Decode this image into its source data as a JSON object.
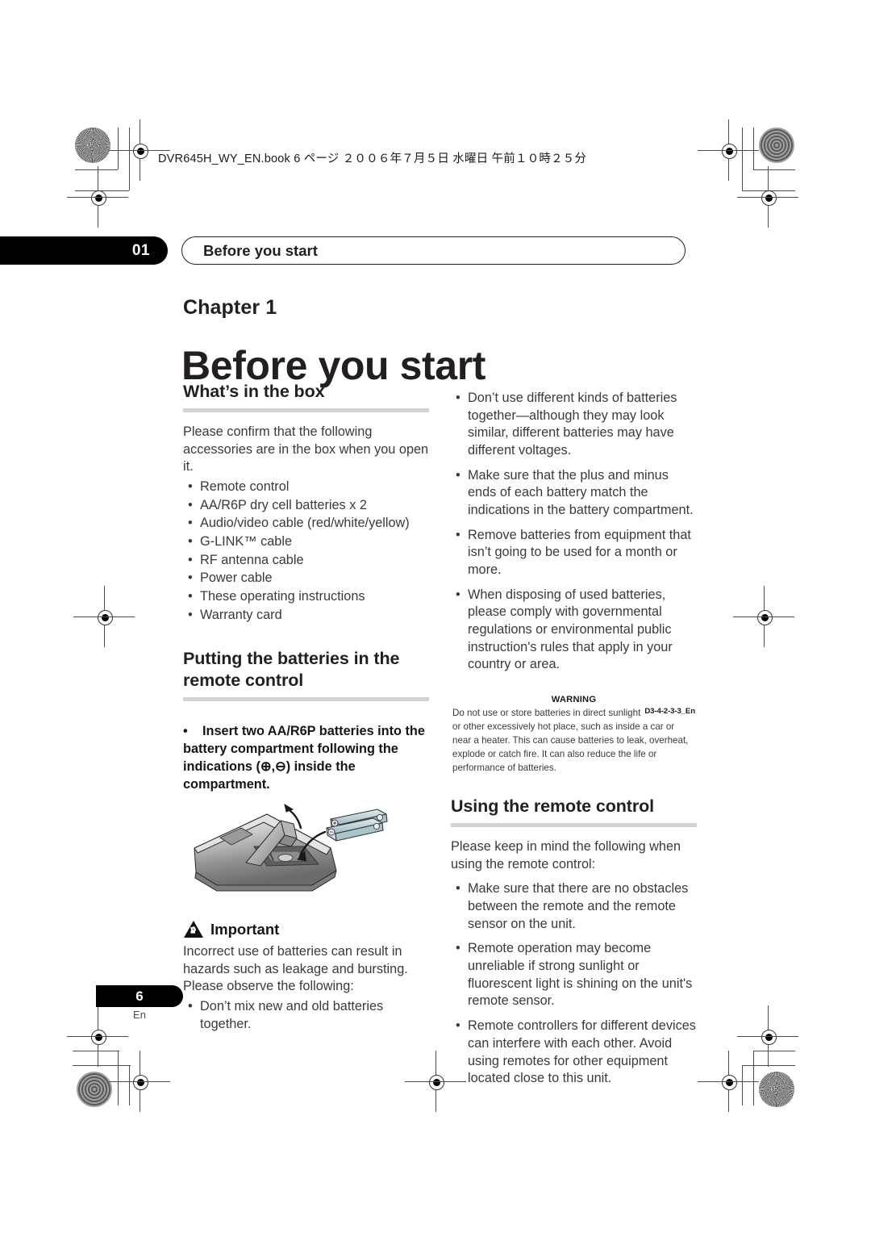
{
  "file_header": "DVR645H_WY_EN.book 6 ページ ２００６年７月５日 水曜日 午前１０時２５分",
  "running_head": {
    "chapter_number": "01",
    "title": "Before you start"
  },
  "chapter": {
    "label": "Chapter 1",
    "title": "Before you start"
  },
  "left_column": {
    "whats_in_the_box": {
      "heading": "What’s in the box",
      "intro": "Please confirm that the following accessories are in the box when you open it.",
      "items": [
        "Remote control",
        "AA/R6P dry cell batteries x 2",
        "Audio/video cable (red/white/yellow)",
        "G-LINK™ cable",
        "RF antenna cable",
        "Power cable",
        "These operating instructions",
        "Warranty card"
      ]
    },
    "putting_batteries": {
      "heading": "Putting the batteries in the remote control",
      "bullet_bold": "Insert two AA/R6P batteries into the battery compartment following the indications (⊕,⊖) inside the compartment.",
      "illustration_caption": "remote-control-battery-compartment"
    },
    "important": {
      "label": "Important",
      "body": "Incorrect use of batteries can result in hazards such as leakage and bursting. Please observe the following:",
      "items": [
        "Don’t mix new and old batteries together."
      ]
    }
  },
  "right_column": {
    "battery_cautions": [
      "Don’t use different kinds of batteries together—although they may look similar, different batteries may have different voltages.",
      "Make sure that the plus and minus ends of each battery match the indications in the battery compartment.",
      "Remove batteries from equipment that isn’t going to be used for a month or more.",
      "When disposing of used batteries, please comply with governmental regulations or environmental public instruction's rules that apply in your country or area."
    ],
    "warning": {
      "title": "WARNING",
      "body": "Do not use or store batteries in direct sunlight or other excessively hot place, such as inside a car or near a heater. This can cause batteries to leak, overheat, explode or catch fire. It can also reduce the life or performance of batteries.",
      "code": "D3-4-2-3-3_En"
    },
    "using_remote": {
      "heading": "Using the remote control",
      "intro": "Please keep in mind the following when using the remote control:",
      "items": [
        "Make sure that there are no obstacles between the remote and the remote sensor on the unit.",
        "Remote operation may become unreliable if strong sunlight or fluorescent light is shining on the unit's remote sensor.",
        "Remote controllers for different devices can interfere with each other. Avoid using remotes for other equipment located close to this unit."
      ]
    }
  },
  "footer": {
    "page_number": "6",
    "language": "En"
  },
  "colors": {
    "text": "#231f20",
    "body_text": "#3a3a3a",
    "rule": "#d3d3d3",
    "tab_background": "#000000",
    "battery_tint": "#bdd4d9"
  }
}
